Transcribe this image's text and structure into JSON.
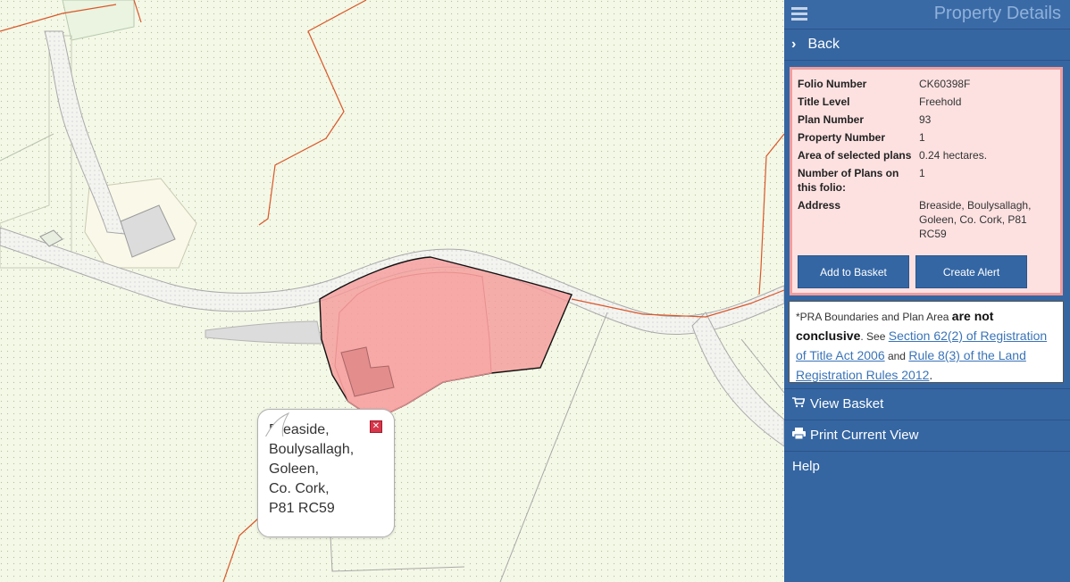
{
  "panel": {
    "title": "Property Details",
    "back_label": "Back",
    "details": [
      {
        "key": "Folio Number",
        "value": "CK60398F"
      },
      {
        "key": "Title Level",
        "value": "Freehold"
      },
      {
        "key": "Plan Number",
        "value": "93"
      },
      {
        "key": "Property Number",
        "value": "1"
      },
      {
        "key": "Area of selected plans",
        "value": "0.24 hectares."
      },
      {
        "key": "Number of Plans on this folio:",
        "value": "1"
      },
      {
        "key": "Address",
        "value": "Breaside, Boulysallagh, Goleen, Co. Cork, P81 RC59"
      }
    ],
    "add_to_basket": "Add to Basket",
    "create_alert": "Create Alert",
    "notice": {
      "prefix": "*PRA Boundaries and Plan Area ",
      "bold": "are not conclusive",
      "see": ". See ",
      "link1": "Section 62(2) of Registration of Title Act 2006",
      "and": " and ",
      "link2": "Rule 8(3) of the Land Registration Rules 2012",
      "end": "."
    },
    "menu": {
      "view_basket": "View Basket",
      "print_view": "Print Current View",
      "help": "Help"
    }
  },
  "popup": {
    "lines": [
      "Breaside,",
      "Boulysallagh,",
      "Goleen,",
      "Co. Cork,",
      "P81 RC59"
    ]
  },
  "colors": {
    "panel_bg": "#3566a2",
    "parcel_fill": "#f59a9a",
    "map_bg": "#f4f8e6",
    "boundary_line": "#d9572a"
  }
}
